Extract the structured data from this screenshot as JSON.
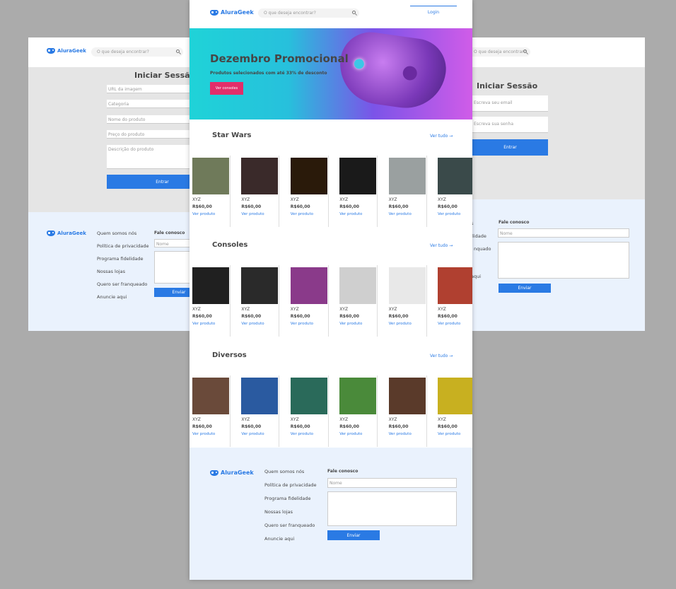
{
  "brand": "AluraGeek",
  "search_placeholder": "O que deseja encontrar?",
  "login": "Login",
  "left": {
    "title": "Iniciar Sessão",
    "fields": [
      "URL da imagem",
      "Categoria",
      "Nome do produto",
      "Preço do produto",
      "Descrição do produto"
    ],
    "button": "Entrar",
    "links": [
      "Quem somos nós",
      "Política de privacidade",
      "Programa fidelidade",
      "Nossas lojas",
      "Quero ser franqueado",
      "Anuncie aqui"
    ],
    "contact": "Fale conosco",
    "name_ph": "Nome",
    "send": "Enviar"
  },
  "right": {
    "title": "Iniciar Sessão",
    "fields": [
      "Escreva seu email",
      "Escreva sua senha"
    ],
    "button": "Entrar",
    "links": [
      "s",
      "lidade",
      "nquado",
      "aqui"
    ],
    "contact": "Fale conosco",
    "name_ph": "Nome",
    "send": "Enviar"
  },
  "banner": {
    "title": "Dezembro Promocional",
    "subtitle": "Produtos selecionados com até 33% de desconto",
    "button": "Ver consoles"
  },
  "sections": [
    {
      "title": "Star Wars",
      "see_all": "Ver tudo",
      "products": [
        {
          "name": "XYZ",
          "price": "R$60,00",
          "link": "Ver produto",
          "color": "#6f7a5a"
        },
        {
          "name": "XYZ",
          "price": "R$60,00",
          "link": "Ver produto",
          "color": "#3a2a2a"
        },
        {
          "name": "XYZ",
          "price": "R$60,00",
          "link": "Ver produto",
          "color": "#2a1a0a"
        },
        {
          "name": "XYZ",
          "price": "R$60,00",
          "link": "Ver produto",
          "color": "#1a1a1a"
        },
        {
          "name": "XYZ",
          "price": "R$60,00",
          "link": "Ver produto",
          "color": "#9aa0a0"
        },
        {
          "name": "XYZ",
          "price": "R$60,00",
          "link": "Ver produto",
          "color": "#3a4a4a"
        }
      ]
    },
    {
      "title": "Consoles",
      "see_all": "Ver tudo",
      "products": [
        {
          "name": "XYZ",
          "price": "R$60,00",
          "link": "Ver produto",
          "color": "#202020"
        },
        {
          "name": "XYZ",
          "price": "R$60,00",
          "link": "Ver produto",
          "color": "#2a2a2a"
        },
        {
          "name": "XYZ",
          "price": "R$60,00",
          "link": "Ver produto",
          "color": "#8a3a8a"
        },
        {
          "name": "XYZ",
          "price": "R$60,00",
          "link": "Ver produto",
          "color": "#cfcfcf"
        },
        {
          "name": "XYZ",
          "price": "R$60,00",
          "link": "Ver produto",
          "color": "#e8e8e8"
        },
        {
          "name": "XYZ",
          "price": "R$60,00",
          "link": "Ver produto",
          "color": "#b04030"
        }
      ]
    },
    {
      "title": "Diversos",
      "see_all": "Ver tudo",
      "products": [
        {
          "name": "XYZ",
          "price": "R$60,00",
          "link": "Ver produto",
          "color": "#6a4a3a"
        },
        {
          "name": "XYZ",
          "price": "R$60,00",
          "link": "Ver produto",
          "color": "#2a5aa0"
        },
        {
          "name": "XYZ",
          "price": "R$60,00",
          "link": "Ver produto",
          "color": "#2a6a5a"
        },
        {
          "name": "XYZ",
          "price": "R$60,00",
          "link": "Ver produto",
          "color": "#4a8a3a"
        },
        {
          "name": "XYZ",
          "price": "R$60,00",
          "link": "Ver produto",
          "color": "#5a3a2a"
        },
        {
          "name": "XYZ",
          "price": "R$60,00",
          "link": "Ver produto",
          "color": "#c8b020"
        }
      ]
    }
  ],
  "footer": {
    "links": [
      "Quem somos nós",
      "Política de privacidade",
      "Programa fidelidade",
      "Nossas lojas",
      "Quero ser franqueado",
      "Anuncie aqui"
    ],
    "contact": "Fale conosco",
    "name_ph": "Nome",
    "send": "Enviar"
  }
}
